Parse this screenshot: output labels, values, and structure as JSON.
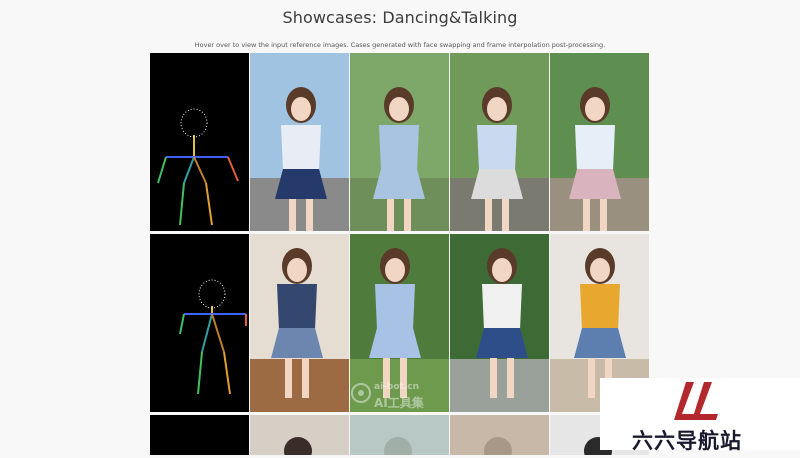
{
  "header": {
    "title": "Showcases: Dancing&Talking",
    "subtitle": "Hover over to view the input reference images. Cases generated with face swapping and frame interpolation post-processing."
  },
  "gallery": {
    "rows": [
      {
        "tiles": [
          {
            "kind": "pose-skeleton"
          },
          {
            "kind": "video-frame",
            "sky": "#9fc3e0",
            "ground": "#8a8a8a",
            "top": "#e8ecf5",
            "bottom": "#253a6a"
          },
          {
            "kind": "video-frame",
            "sky": "#7ea86a",
            "ground": "#6e8f5a",
            "top": "#a9c4e0",
            "bottom": "#a9c4e0"
          },
          {
            "kind": "video-frame",
            "sky": "#6f9a5a",
            "ground": "#7a7a70",
            "top": "#c9d9ef",
            "bottom": "#dcdcdc"
          },
          {
            "kind": "video-frame",
            "sky": "#5f8f50",
            "ground": "#9a9080",
            "top": "#e6eef8",
            "bottom": "#d9b3be"
          }
        ]
      },
      {
        "tiles": [
          {
            "kind": "pose-skeleton"
          },
          {
            "kind": "video-frame",
            "sky": "#e5ddd2",
            "ground": "#9c6b44",
            "top": "#34476e",
            "bottom": "#6d86b0"
          },
          {
            "kind": "video-frame",
            "sky": "#4f7c3d",
            "ground": "#6e9a4e",
            "top": "#a8c2e6",
            "bottom": "#a8c2e6"
          },
          {
            "kind": "video-frame",
            "sky": "#3e6a36",
            "ground": "#9aa09a",
            "top": "#f0f0f0",
            "bottom": "#2e4e8a"
          },
          {
            "kind": "video-frame",
            "sky": "#e8e4df",
            "ground": "#c8bca8",
            "top": "#e8a830",
            "bottom": "#5c7fb0"
          }
        ]
      },
      {
        "tiles": [
          {
            "kind": "pose-skeleton"
          },
          {
            "kind": "video-frame",
            "sky": "#d6cfc6",
            "ground": "#d6cfc6",
            "top": "#3a2c28",
            "bottom": "#3a2c28"
          },
          {
            "kind": "video-frame",
            "sky": "#b8c8c4",
            "ground": "#b8c8c4",
            "top": "#a0b0a8",
            "bottom": "#a0b0a8"
          },
          {
            "kind": "video-frame",
            "sky": "#c7b8a8",
            "ground": "#c7b8a8",
            "top": "#a89888",
            "bottom": "#a89888"
          },
          {
            "kind": "video-frame",
            "sky": "#e6e6e6",
            "ground": "#e6e6e6",
            "top": "#2a2a2a",
            "bottom": "#2a2a2a"
          }
        ]
      }
    ]
  },
  "watermark": {
    "line1": "ai-bot.cn",
    "line2": "AI工具集"
  },
  "corner_logo": {
    "text": "六六导航站",
    "accent": "#b3282d"
  }
}
